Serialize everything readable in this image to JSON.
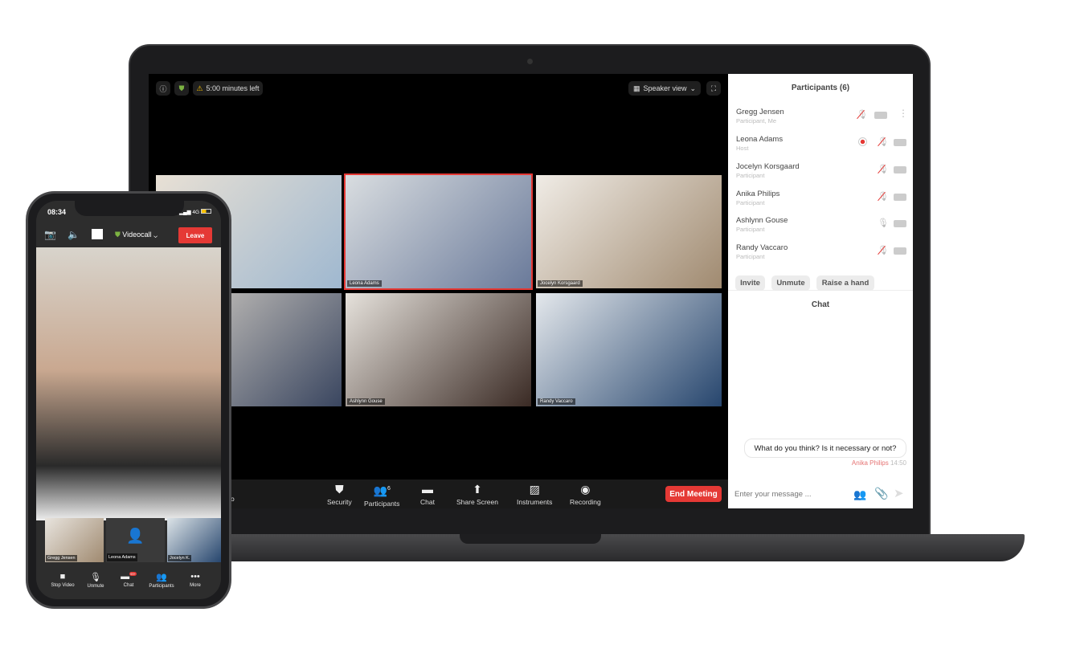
{
  "laptop": {
    "topbar": {
      "timer": "5:00 minutes left",
      "view": "Speaker view",
      "icons": [
        "info-icon",
        "shield-check-icon",
        "warning-icon",
        "fullscreen-icon"
      ]
    },
    "tiles": [
      {
        "name": ""
      },
      {
        "name": "Leona Adams",
        "active": true
      },
      {
        "name": "Jocelyn Korsgaard"
      },
      {
        "name": ""
      },
      {
        "name": "Ashlynn Gouse"
      },
      {
        "name": "Randy Vaccaro"
      }
    ],
    "toolbar": {
      "partial_label": "o",
      "items": [
        {
          "label": "Security",
          "icon": "shield-icon"
        },
        {
          "label": "Participants",
          "icon": "participants-icon",
          "badge": "6"
        },
        {
          "label": "Chat",
          "icon": "chat-icon"
        },
        {
          "label": "Share Screen",
          "icon": "share-screen-icon"
        },
        {
          "label": "Instruments",
          "icon": "instruments-icon"
        },
        {
          "label": "Recording",
          "icon": "record-icon"
        }
      ],
      "end": "End Meeting"
    },
    "panel": {
      "title": "Participants (6)",
      "participants": [
        {
          "name": "Gregg Jensen",
          "role": "Participant, Me",
          "muted": true
        },
        {
          "name": "Leona Adams",
          "role": "Host",
          "muted": true,
          "recording": true
        },
        {
          "name": "Jocelyn Korsgaard",
          "role": "Participant",
          "muted": true
        },
        {
          "name": "Anika Philips",
          "role": "Participant",
          "muted": true
        },
        {
          "name": "Ashlynn Gouse",
          "role": "Participant",
          "muted": false
        },
        {
          "name": "Randy Vaccaro",
          "role": "Participant",
          "muted": true
        }
      ],
      "buttons": [
        "Invite",
        "Unmute",
        "Raise a hand"
      ],
      "chat_title": "Chat",
      "message": {
        "text": "What do you think? Is it necessary or not?",
        "author": "Anika Philips",
        "time": "14:50"
      },
      "input_placeholder": "Enter your message ...",
      "accent": "#e53935"
    }
  },
  "phone": {
    "time": "08:34",
    "network": "4G",
    "call_name": "Videocall",
    "leave": "Leave",
    "thumbs": [
      "Gregg Jensen",
      "Leona Adams",
      "Jocelyn K."
    ],
    "nav": [
      {
        "label": "Stop Video",
        "icon": "video-icon"
      },
      {
        "label": "Unmute",
        "icon": "mic-off-icon"
      },
      {
        "label": "Chat",
        "icon": "chat-icon",
        "badge": "99+"
      },
      {
        "label": "Participants",
        "icon": "participants-icon"
      },
      {
        "label": "More",
        "icon": "more-icon"
      }
    ]
  }
}
